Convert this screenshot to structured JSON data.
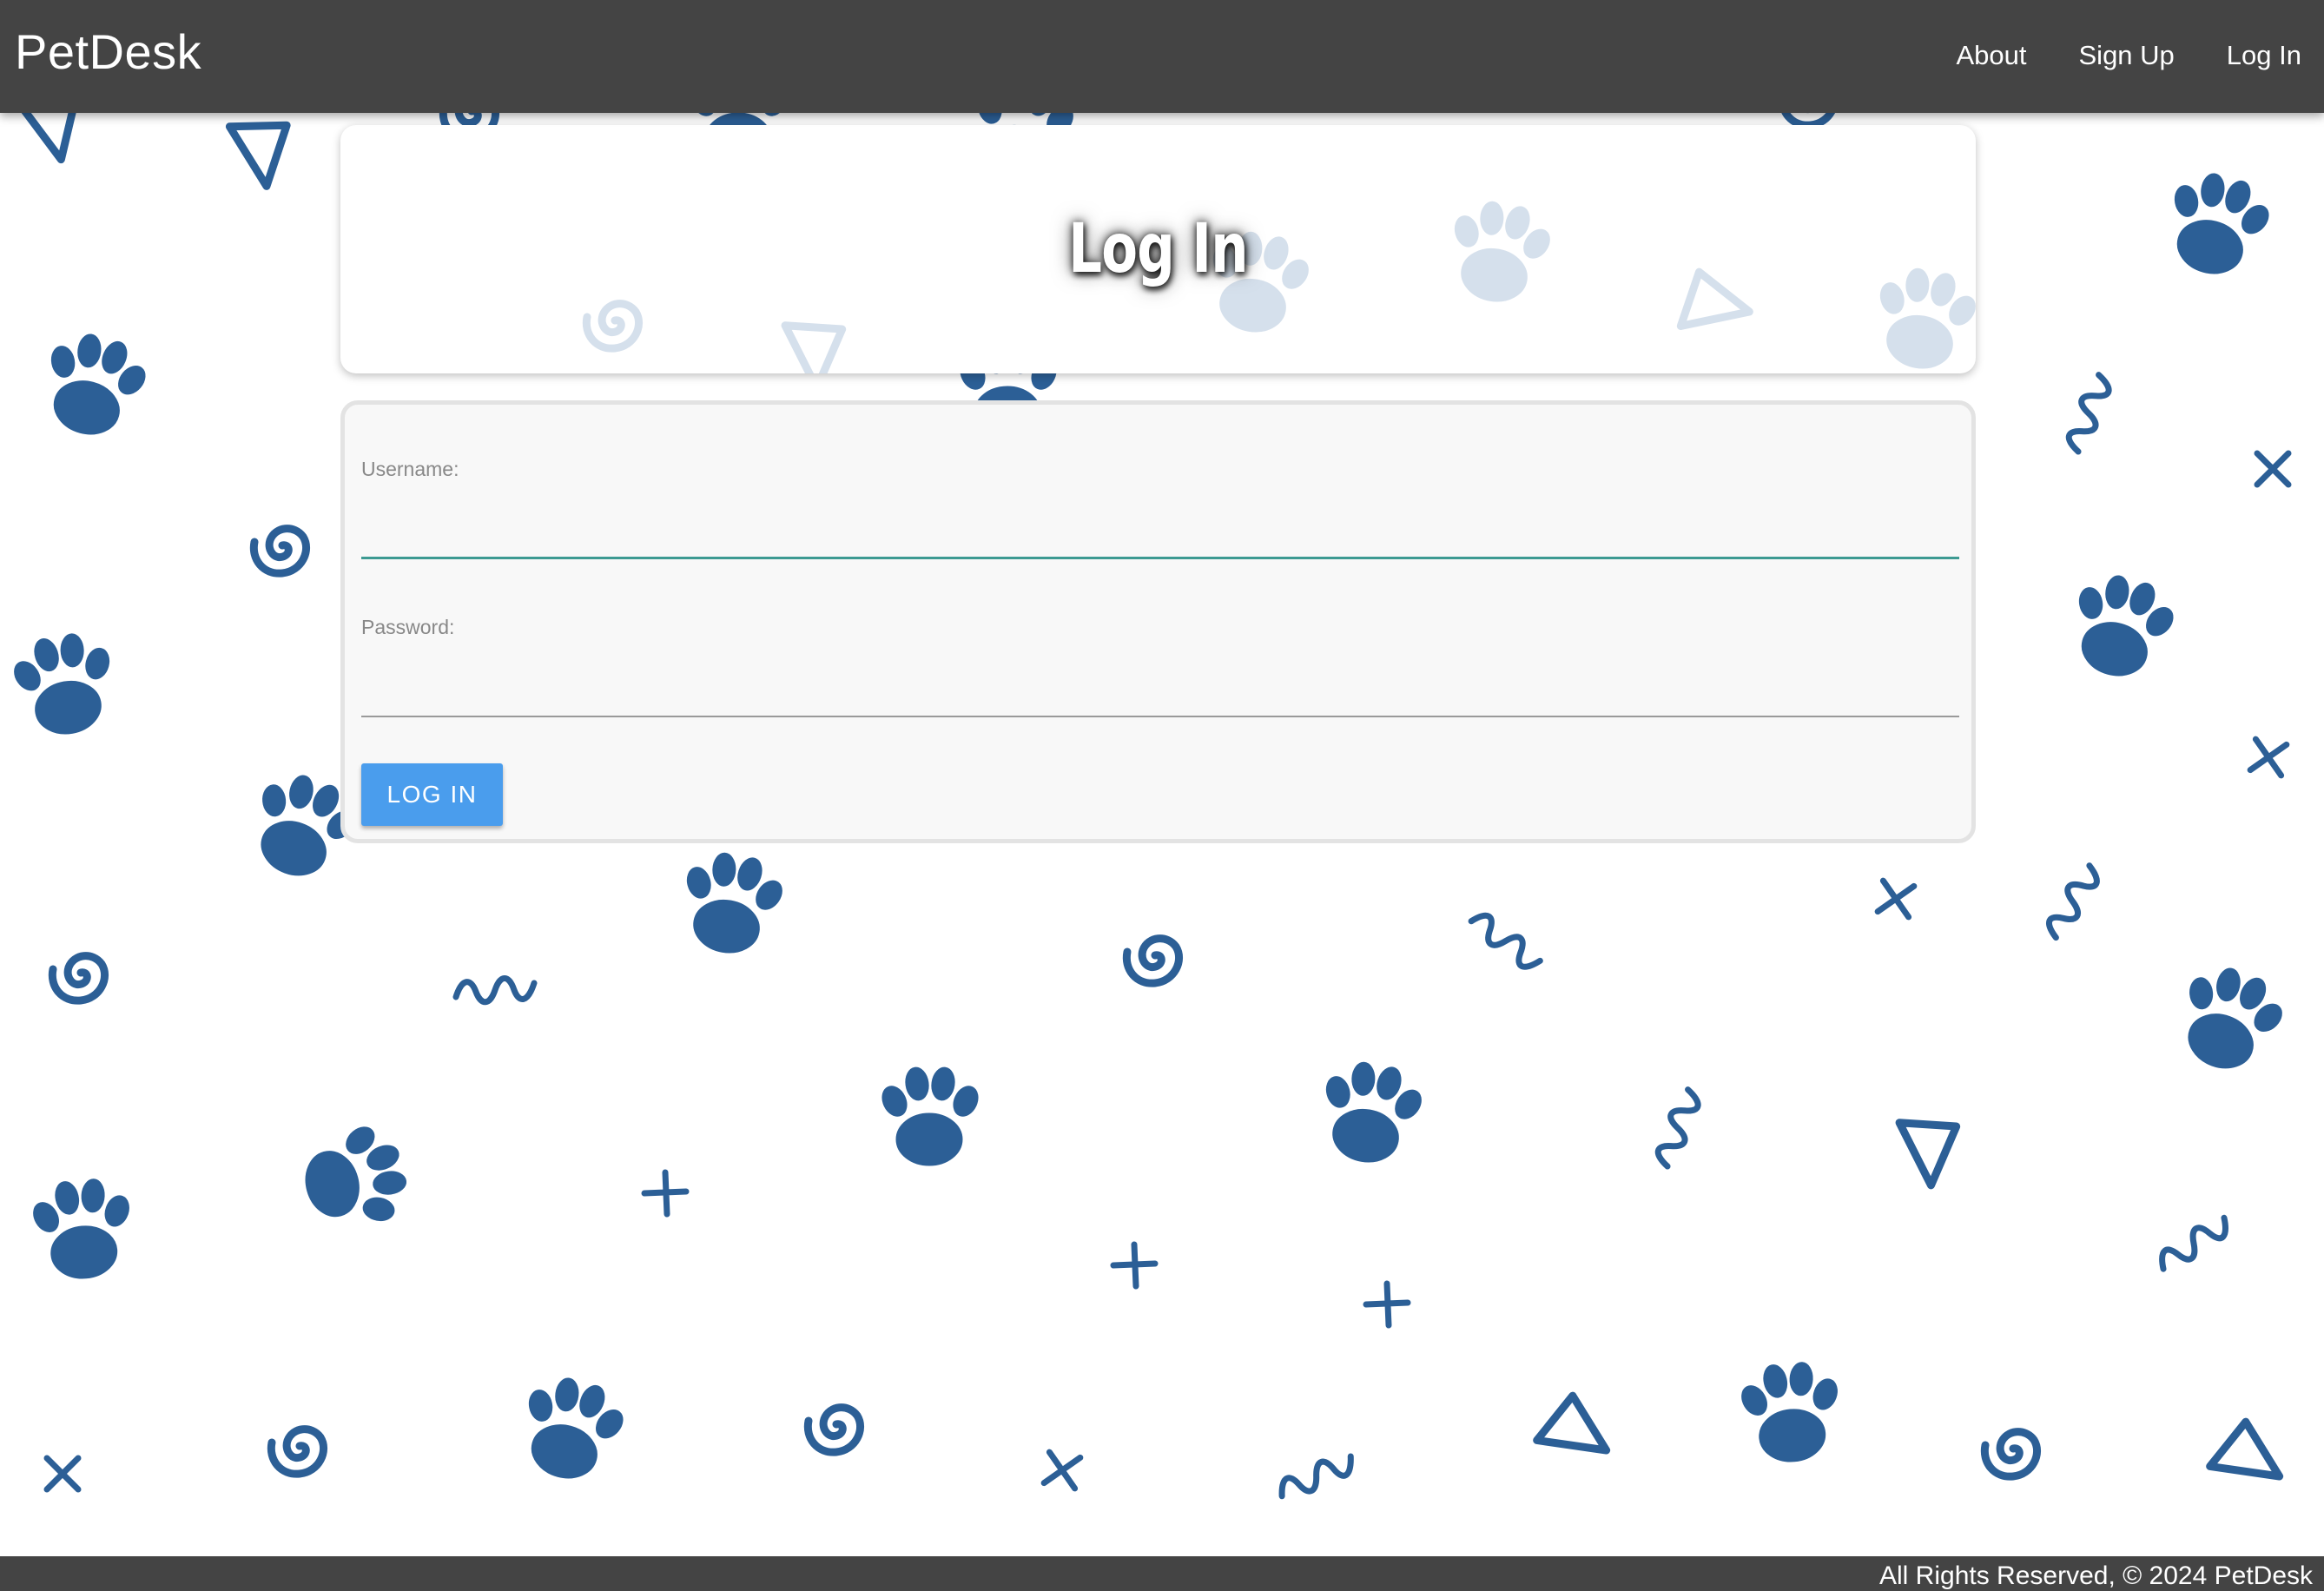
{
  "navbar": {
    "brand": "PetDesk",
    "links": [
      {
        "label": "About"
      },
      {
        "label": "Sign Up"
      },
      {
        "label": "Log In"
      }
    ]
  },
  "header": {
    "title": "Log In"
  },
  "form": {
    "username_label": "Username:",
    "username_value": "",
    "password_label": "Password:",
    "password_value": "",
    "submit_label": "LOG IN"
  },
  "footer": {
    "text": "All Rights Reserved, © 2024 PetDesk"
  },
  "colors": {
    "navbar_bg": "#444444",
    "pattern": "#2c5f96",
    "button": "#4a9ded",
    "input_focus": "#3d9a92"
  },
  "background_icons": [
    "paw-print-icon",
    "triangle-icon",
    "spiral-icon",
    "squiggle-icon",
    "cross-icon",
    "plus-icon"
  ]
}
